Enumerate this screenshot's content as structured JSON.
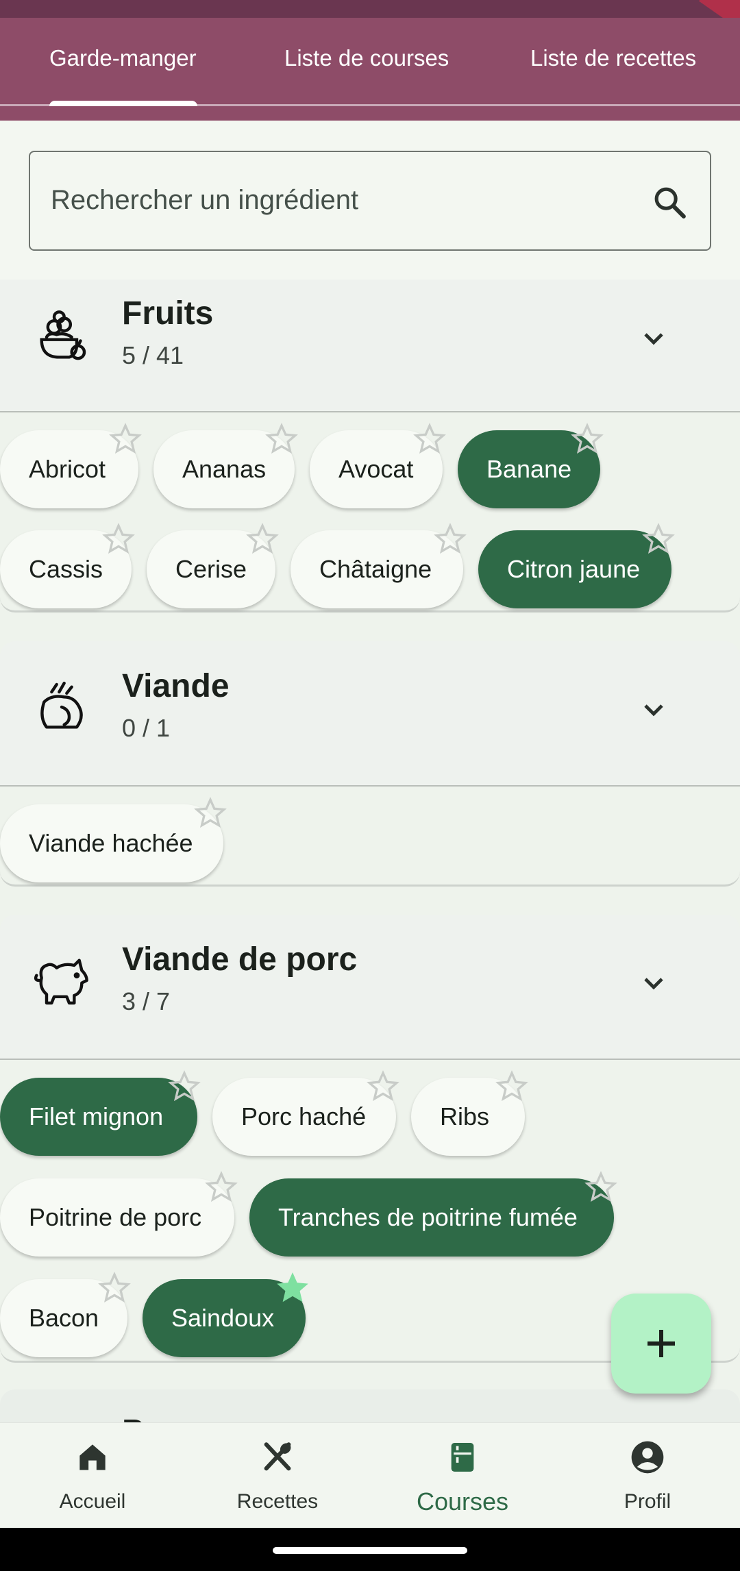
{
  "tabs": [
    {
      "label": "Garde-manger",
      "active": true
    },
    {
      "label": "Liste de courses",
      "active": false
    },
    {
      "label": "Liste de recettes",
      "active": false
    }
  ],
  "search": {
    "placeholder": "Rechercher un ingrédient",
    "icon": "search-icon"
  },
  "categories": [
    {
      "title": "Fruits",
      "count": "5 / 41",
      "icon": "fruit-basket-icon",
      "chips": [
        {
          "label": "Abricot",
          "selected": false,
          "starred": false
        },
        {
          "label": "Ananas",
          "selected": false,
          "starred": false
        },
        {
          "label": "Avocat",
          "selected": false,
          "starred": false
        },
        {
          "label": "Banane",
          "selected": true,
          "starred": false
        },
        {
          "label": "Cassis",
          "selected": false,
          "starred": false
        },
        {
          "label": "Cerise",
          "selected": false,
          "starred": false
        },
        {
          "label": "Châtaigne",
          "selected": false,
          "starred": false
        },
        {
          "label": "Citron jaune",
          "selected": true,
          "starred": false
        }
      ]
    },
    {
      "title": "Viande",
      "count": "0 / 1",
      "icon": "meat-icon",
      "chips": [
        {
          "label": "Viande hachée",
          "selected": false,
          "starred": false
        }
      ]
    },
    {
      "title": "Viande de porc",
      "count": "3 / 7",
      "icon": "pig-icon",
      "chips": [
        {
          "label": "Filet mignon",
          "selected": true,
          "starred": false
        },
        {
          "label": "Porc haché",
          "selected": false,
          "starred": false
        },
        {
          "label": "Ribs",
          "selected": false,
          "starred": false
        },
        {
          "label": "Poitrine de porc",
          "selected": false,
          "starred": false
        },
        {
          "label": "Tranches de poitrine fumée",
          "selected": true,
          "starred": false
        },
        {
          "label": "Bacon",
          "selected": false,
          "starred": false
        },
        {
          "label": "Saindoux",
          "selected": true,
          "starred": true
        }
      ]
    }
  ],
  "peek_title": "P...",
  "nav": [
    {
      "label": "Accueil",
      "icon": "home-icon",
      "active": false
    },
    {
      "label": "Recettes",
      "icon": "utensils-icon",
      "active": false
    },
    {
      "label": "Courses",
      "icon": "pantry-icon",
      "active": true
    },
    {
      "label": "Profil",
      "icon": "profile-icon",
      "active": false
    }
  ],
  "colors": {
    "primary": "#2e6a47",
    "tabbar": "#8e4c68",
    "fab": "#b3f2c6",
    "star_active": "#7ee0a0"
  }
}
